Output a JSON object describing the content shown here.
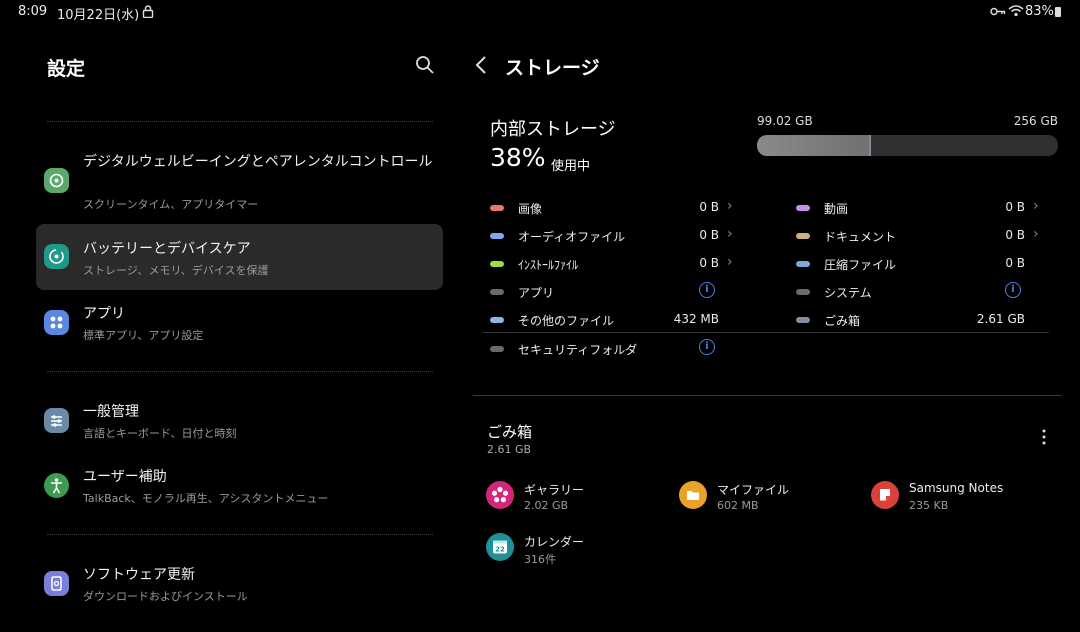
{
  "status": {
    "time": "8:09",
    "date": "10月22日(水)",
    "battery": "83%"
  },
  "left": {
    "title": "設定",
    "items": [
      {
        "title": "デジタルウェルビーイングとペアレンタルコントロール",
        "subtitle": "スクリーンタイム、アプリタイマー"
      },
      {
        "title": "バッテリーとデバイスケア",
        "subtitle": "ストレージ、メモリ、デバイスを保護"
      },
      {
        "title": "アプリ",
        "subtitle": "標準アプリ、アプリ設定"
      },
      {
        "title": "一般管理",
        "subtitle": "言語とキーボード、日付と時刻"
      },
      {
        "title": "ユーザー補助",
        "subtitle": "TalkBack、モノラル再生、アシスタントメニュー"
      },
      {
        "title": "ソフトウェア更新",
        "subtitle": "ダウンロードおよびインストール"
      }
    ]
  },
  "right": {
    "title": "ストレージ",
    "internal": {
      "label": "内部ストレージ",
      "percent": "38%",
      "percent_suffix": "使用中",
      "used": "99.02 GB",
      "total": "256 GB",
      "used_fraction": 0.38
    },
    "categories_left": [
      {
        "name": "画像",
        "value": "0 B",
        "color": "#e8756f"
      },
      {
        "name": "オーディオファイル",
        "value": "0 B",
        "color": "#7fa7ef"
      },
      {
        "name": "ｲﾝｽﾄｰﾙﾌｧｲﾙ",
        "value": "0 B",
        "color": "#9ddd3f"
      },
      {
        "name": "アプリ",
        "value": "",
        "color": "#6a6a6a"
      },
      {
        "name": "その他のファイル",
        "value": "432 MB",
        "color": "#8eb4e3"
      },
      {
        "name": "セキュリティフォルダ",
        "value": "",
        "color": "#6a6a6a"
      }
    ],
    "categories_right": [
      {
        "name": "動画",
        "value": "0 B",
        "color": "#c78ee6"
      },
      {
        "name": "ドキュメント",
        "value": "0 B",
        "color": "#cdae86"
      },
      {
        "name": "圧縮ファイル",
        "value": "0 B",
        "color": "#7fa7d8"
      },
      {
        "name": "システム",
        "value": "",
        "color": "#6a6a6a"
      },
      {
        "name": "ごみ箱",
        "value": "2.61 GB",
        "color": "#7f8da0"
      }
    ],
    "trash": {
      "title": "ごみ箱",
      "size": "2.61 GB",
      "apps": [
        {
          "name": "ギャラリー",
          "size": "2.02 GB",
          "color": "#d4267a"
        },
        {
          "name": "マイファイル",
          "size": "602 MB",
          "color": "#e9a22a"
        },
        {
          "name": "Samsung Notes",
          "size": "235 KB",
          "color": "#d9423a"
        },
        {
          "name": "カレンダー",
          "size": "316件",
          "color": "#1f8f9a",
          "icon_text": "22"
        }
      ]
    }
  }
}
